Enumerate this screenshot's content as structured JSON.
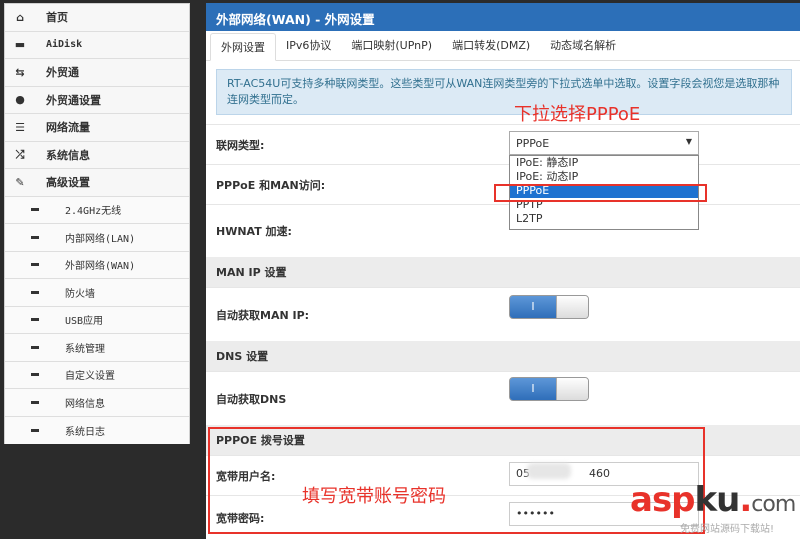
{
  "sidebar": {
    "items": [
      {
        "label": "首页",
        "icon": "home-icon",
        "glyph": "⌂"
      },
      {
        "label": "AiDisk",
        "icon": "disk-icon",
        "glyph": "▬"
      },
      {
        "label": "外贸通",
        "icon": "refresh-icon",
        "glyph": "⇆"
      },
      {
        "label": "外贸通设置",
        "icon": "globe-icon",
        "glyph": "●"
      },
      {
        "label": "网络流量",
        "icon": "list-icon",
        "glyph": "☰"
      },
      {
        "label": "系统信息",
        "icon": "shuffle-icon",
        "glyph": "⤮"
      },
      {
        "label": "高级设置",
        "icon": "wrench-icon",
        "glyph": "✎"
      }
    ],
    "subitems": [
      "2.4GHz无线",
      "内部网络(LAN)",
      "外部网络(WAN)",
      "防火墙",
      "USB应用",
      "系统管理",
      "自定义设置",
      "网络信息",
      "系统日志"
    ]
  },
  "header": {
    "title": "外部网络(WAN) - 外网设置"
  },
  "tabs": [
    "外网设置",
    "IPv6协议",
    "端口映射(UPnP)",
    "端口转发(DMZ)",
    "动态域名解析"
  ],
  "info": "RT-AC54U可支持多种联网类型。这些类型可从WAN连网类型旁的下拉式选单中选取。设置字段会视您是选取那种连网类型而定。",
  "form": {
    "wan_type_label": "联网类型:",
    "wan_type_value": "PPPoE",
    "wan_type_options": [
      "IPoE: 静态IP",
      "IPoE: 动态IP",
      "PPPoE",
      "PPTP",
      "L2TP"
    ],
    "pppoe_man_label": "PPPoE 和MAN访问:",
    "hwnat_label": "HWNAT 加速:",
    "man_ip_section": "MAN IP 设置",
    "man_ip_auto_label": "自动获取MAN IP:",
    "dns_section": "DNS 设置",
    "dns_auto_label": "自动获取DNS",
    "toggle_on_label": "I",
    "pppoe_section": "PPPOE 拨号设置",
    "username_label": "宽带用户名:",
    "username_prefix": "05",
    "username_suffix": "460",
    "password_label": "宽带密码:",
    "password_value": "••••••"
  },
  "annotations": {
    "dropdown_hint": "下拉选择PPPoE",
    "account_hint": "填写宽带账号密码"
  },
  "watermark": {
    "asp": "asp",
    "ku": "ku",
    "dot": ".",
    "com": "com",
    "sub": "免费网站源码下载站!"
  },
  "colors": {
    "header_blue": "#2c6fb8",
    "annotation_red": "#e8322a",
    "selected_option": "#1e72d0"
  }
}
